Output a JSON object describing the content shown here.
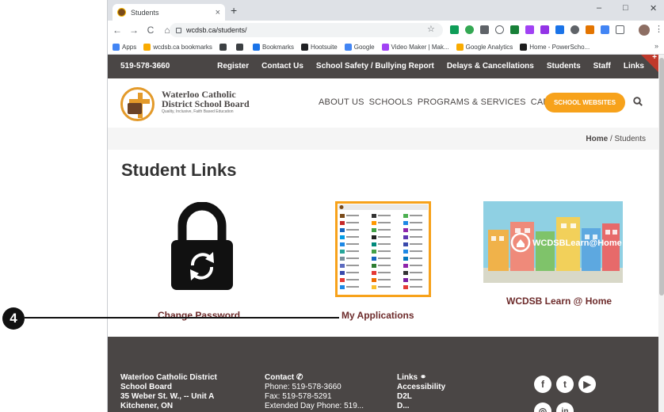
{
  "browser": {
    "tab_title": "Students",
    "tab_close": "×",
    "new_tab": "+",
    "minimize": "–",
    "maximize": "□",
    "close": "✕",
    "back": "←",
    "forward": "→",
    "reload": "C",
    "home": "⌂",
    "url": "wcdsb.ca/students/",
    "star": "☆",
    "menu": "⋮",
    "bookmarks": [
      {
        "label": "Apps",
        "color": "#4285f4"
      },
      {
        "label": "wcdsb.ca bookmarks",
        "color": "#f9ab00"
      },
      {
        "label": "",
        "color": "#3c4043"
      },
      {
        "label": "",
        "color": "#3c4043"
      },
      {
        "label": "Bookmarks",
        "color": "#1a73e8"
      },
      {
        "label": "Hootsuite",
        "color": "#202124"
      },
      {
        "label": "Google",
        "color": "#4285f4"
      },
      {
        "label": "Video Maker | Mak...",
        "color": "#a142f4"
      },
      {
        "label": "Google Analytics",
        "color": "#f9ab00"
      },
      {
        "label": "Home - PowerScho...",
        "color": "#1d1d1d"
      }
    ],
    "bookmarks_more": "»"
  },
  "site": {
    "phone": "519-578-3660",
    "top_links": [
      "Register",
      "Contact Us",
      "School Safety / Bullying Report",
      "Delays & Cancellations",
      "Students",
      "Staff",
      "Links"
    ],
    "corner_plus": "+",
    "logo_line1": "Waterloo Catholic",
    "logo_line2": "District School Board",
    "logo_tagline": "Quality, Inclusive, Faith Based Education",
    "nav": [
      "ABOUT US",
      "SCHOOLS",
      "PROGRAMS & SERVICES",
      "CAREERS"
    ],
    "school_websites": "SCHOOL WEBSITES",
    "breadcrumb_home": "Home",
    "breadcrumb_sep": "/",
    "breadcrumb_current": "Students",
    "page_title": "Student Links",
    "links": [
      {
        "label": "Change Password",
        "icon": "lock-icon"
      },
      {
        "label": "My Applications",
        "icon": "apps-screenshot"
      },
      {
        "label": "WCDSB Learn @ Home",
        "banner_text": "WCDSBLearn@Home",
        "icon": "learn-at-home-banner"
      }
    ],
    "footer": {
      "col1": [
        "Waterloo Catholic District",
        "School Board",
        "35 Weber St. W., -- Unit A",
        "Kitchener, ON"
      ],
      "col2_title": "Contact",
      "col2": [
        "Phone: 519-578-3660",
        "Fax: 519-578-5291",
        "Extended Day Phone: 519..."
      ],
      "col3_title": "Links",
      "col3": [
        "Accessibility",
        "D2L",
        "D..."
      ],
      "social": [
        {
          "icon": "facebook-icon",
          "glyph": "f"
        },
        {
          "icon": "twitter-icon",
          "glyph": "t"
        },
        {
          "icon": "youtube-icon",
          "glyph": "▶"
        },
        {
          "icon": "instagram-icon",
          "glyph": "◎"
        },
        {
          "icon": "linkedin-icon",
          "glyph": "in"
        }
      ]
    }
  },
  "annotation": {
    "number": "4"
  },
  "colors": {
    "topbar": "#4a4645",
    "accent_orange": "#f7a21b",
    "link_maroon": "#6d2b2b"
  }
}
